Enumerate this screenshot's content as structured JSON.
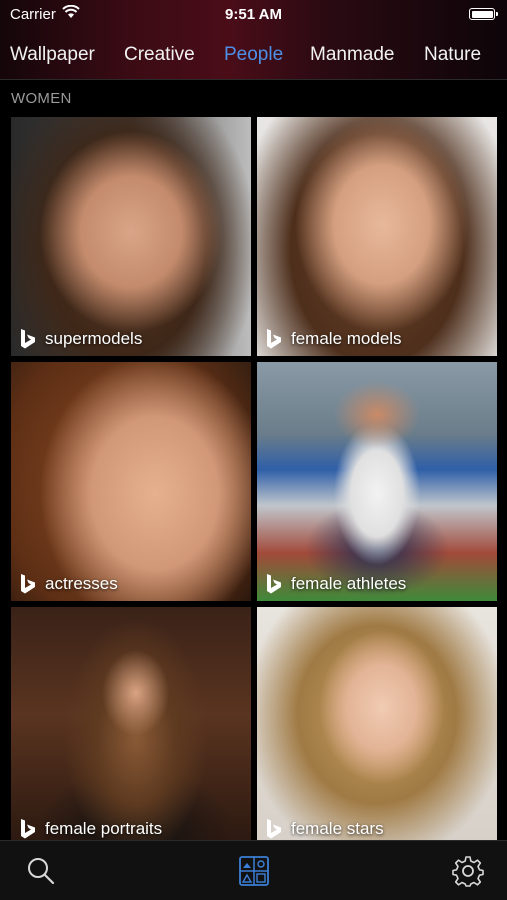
{
  "status_bar": {
    "carrier": "Carrier",
    "time": "9:51 AM"
  },
  "tabs": [
    {
      "label": "Wallpaper",
      "active": false
    },
    {
      "label": "Creative",
      "active": false
    },
    {
      "label": "People",
      "active": true
    },
    {
      "label": "Manmade",
      "active": false
    },
    {
      "label": "Nature",
      "active": false
    }
  ],
  "colors": {
    "active_tab": "#4d8fe6",
    "header_red": "#4a0d18"
  },
  "section": {
    "title": "WOMEN"
  },
  "tiles": [
    {
      "label": "supermodels",
      "icon": "bing-icon"
    },
    {
      "label": "female models",
      "icon": "bing-icon"
    },
    {
      "label": "actresses",
      "icon": "bing-icon"
    },
    {
      "label": "female athletes",
      "icon": "bing-icon"
    },
    {
      "label": "female portraits",
      "icon": "bing-icon"
    },
    {
      "label": "female stars",
      "icon": "bing-icon"
    }
  ],
  "tabbar": {
    "items": [
      "search-icon",
      "gallery-icon",
      "gear-icon"
    ]
  }
}
